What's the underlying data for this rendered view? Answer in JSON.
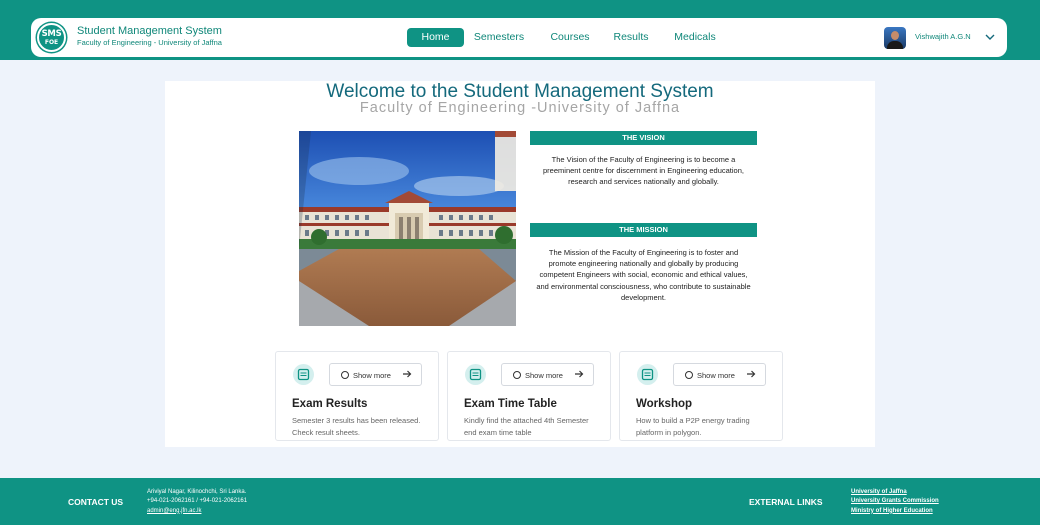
{
  "brand": {
    "logo_top": "SMS",
    "logo_bottom": "FOE",
    "title": "Student Management System",
    "subtitle": "Faculty of Engineering - University of Jaffna"
  },
  "nav": {
    "items": [
      {
        "label": "Home",
        "active": true
      },
      {
        "label": "Semesters",
        "active": false
      },
      {
        "label": "Courses",
        "active": false
      },
      {
        "label": "Results",
        "active": false
      },
      {
        "label": "Medicals",
        "active": false
      }
    ]
  },
  "user": {
    "name": "Vishwajith A.G.N"
  },
  "hero": {
    "title": "Welcome to the Student Management System",
    "subtitle": "Faculty of Engineering -University of Jaffna"
  },
  "vision": {
    "heading": "THE VISION",
    "text": "The Vision of the Faculty of Engineering is to become a preeminent centre for discernment in Engineering education, research and services nationally and globally."
  },
  "mission": {
    "heading": "THE MISSION",
    "text": "The Mission of the Faculty of Engineering is to foster and promote engineering nationally and globally by producing competent Engineers with social, economic and ethical values, and environmental consciousness, who contribute to sustainable development."
  },
  "cards": [
    {
      "title": "Exam Results",
      "button": "Show more",
      "desc": "Semester 3 results has been released. Check result sheets."
    },
    {
      "title": "Exam Time Table",
      "button": "Show more",
      "desc": "Kindly find the attached 4th Semester end exam time table"
    },
    {
      "title": "Workshop",
      "button": "Show more",
      "desc": "How to build a P2P energy trading platform in polygon."
    }
  ],
  "footer": {
    "contact_label": "CONTACT US",
    "address": "Ariviyal Nagar, Kilinochchi, Sri Lanka.",
    "phone": "+94-021-2062161 / +94-021-2062161",
    "email": "admin@eng.jfn.ac.lk",
    "external_label": "EXTERNAL LINKS",
    "links": [
      "University of Jaffna",
      "University Grants Commission",
      "Ministry of Higher Education"
    ]
  },
  "colors": {
    "primary": "#0f9384",
    "page_bg": "#eef3fb",
    "title_text": "#14697c"
  }
}
